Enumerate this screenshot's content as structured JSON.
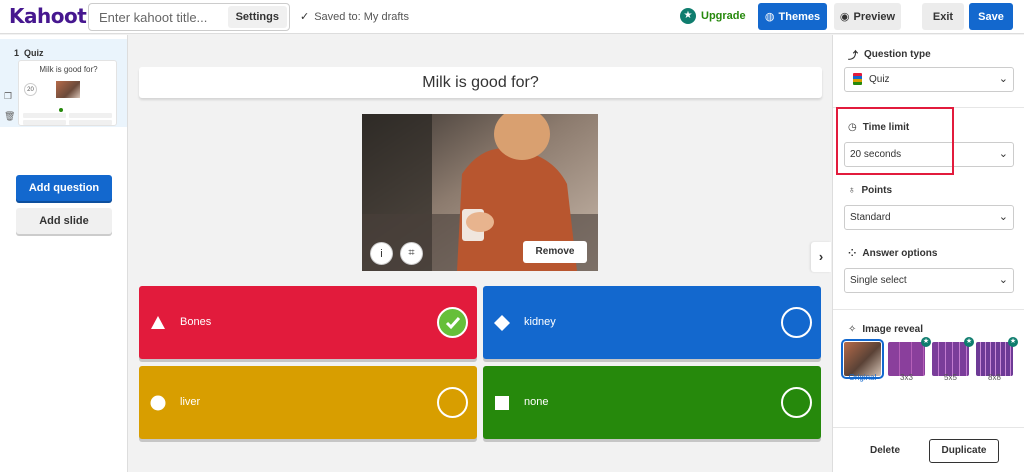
{
  "app": {
    "logo": "Kahoot!"
  },
  "header": {
    "title_placeholder": "Enter kahoot title...",
    "settings_label": "Settings",
    "saved_status": "Saved to: My drafts",
    "upgrade_label": "Upgrade",
    "themes_label": "Themes",
    "preview_label": "Preview",
    "exit_label": "Exit",
    "save_label": "Save"
  },
  "sidebar": {
    "slides": [
      {
        "number": "1",
        "type": "Quiz",
        "question": "Milk is good for?",
        "timer": "20"
      }
    ],
    "add_question_label": "Add question",
    "add_slide_label": "Add slide"
  },
  "editor": {
    "question": "Milk is good for?",
    "media": {
      "remove_label": "Remove"
    },
    "answers": [
      {
        "text": "Bones",
        "shape": "triangle",
        "color": "#e21b3c",
        "correct": true
      },
      {
        "text": "kidney",
        "shape": "diamond",
        "color": "#1368ce",
        "correct": false
      },
      {
        "text": "liver",
        "shape": "circle",
        "color": "#d89e00",
        "correct": false
      },
      {
        "text": "none",
        "shape": "square",
        "color": "#26890c",
        "correct": false
      }
    ]
  },
  "settings_panel": {
    "question_type": {
      "label": "Question type",
      "value": "Quiz"
    },
    "time_limit": {
      "label": "Time limit",
      "value": "20 seconds"
    },
    "points": {
      "label": "Points",
      "value": "Standard"
    },
    "answer_options": {
      "label": "Answer options",
      "value": "Single select"
    },
    "image_reveal": {
      "label": "Image reveal",
      "options": [
        {
          "label": "Original",
          "selected": true
        },
        {
          "label": "3x3",
          "premium": true
        },
        {
          "label": "5x5",
          "premium": true
        },
        {
          "label": "8x8",
          "premium": true
        }
      ]
    },
    "delete_label": "Delete",
    "duplicate_label": "Duplicate"
  },
  "colors": {
    "brand": "#46178f",
    "primary": "#1368ce",
    "red": "#e21b3c",
    "blue": "#1368ce",
    "yellow": "#d89e00",
    "green": "#26890c",
    "highlight": "#e21b3c"
  }
}
